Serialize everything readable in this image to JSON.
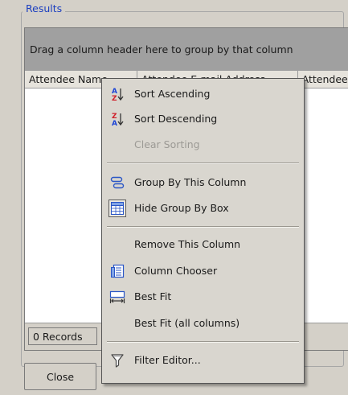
{
  "groupbox": {
    "legend": "Results"
  },
  "grid": {
    "group_panel_text": "Drag a column header here to group by that column",
    "columns": [
      {
        "label": "Attendee Name"
      },
      {
        "label": "Attendee E-mail Address"
      },
      {
        "label": "Attendee"
      }
    ],
    "records_label": "0 Records"
  },
  "buttons": {
    "close_label": "Close"
  },
  "context_menu": {
    "items": [
      {
        "label": "Sort Ascending",
        "icon": "sort-ascending-icon",
        "enabled": true
      },
      {
        "label": "Sort Descending",
        "icon": "sort-descending-icon",
        "enabled": true
      },
      {
        "label": "Clear Sorting",
        "icon": "",
        "enabled": false
      },
      {
        "label": "Group By This Column",
        "icon": "group-by-icon",
        "enabled": true
      },
      {
        "label": "Hide Group By Box",
        "icon": "group-box-icon",
        "enabled": true
      },
      {
        "label": "Remove This Column",
        "icon": "",
        "enabled": true
      },
      {
        "label": "Column Chooser",
        "icon": "column-chooser-icon",
        "enabled": true
      },
      {
        "label": "Best Fit",
        "icon": "best-fit-icon",
        "enabled": true
      },
      {
        "label": "Best Fit (all columns)",
        "icon": "",
        "enabled": true
      },
      {
        "label": "Filter Editor...",
        "icon": "filter-icon",
        "enabled": true
      }
    ]
  },
  "colors": {
    "window_bg": "#d4d0c8",
    "legend_text": "#1c3fc0",
    "group_panel_bg": "#a0a0a0",
    "menu_bg": "#d9d6cf",
    "disabled_text": "#9c9a95",
    "sort_a_blue": "#1c44d6",
    "sort_z_red": "#d0202a"
  }
}
